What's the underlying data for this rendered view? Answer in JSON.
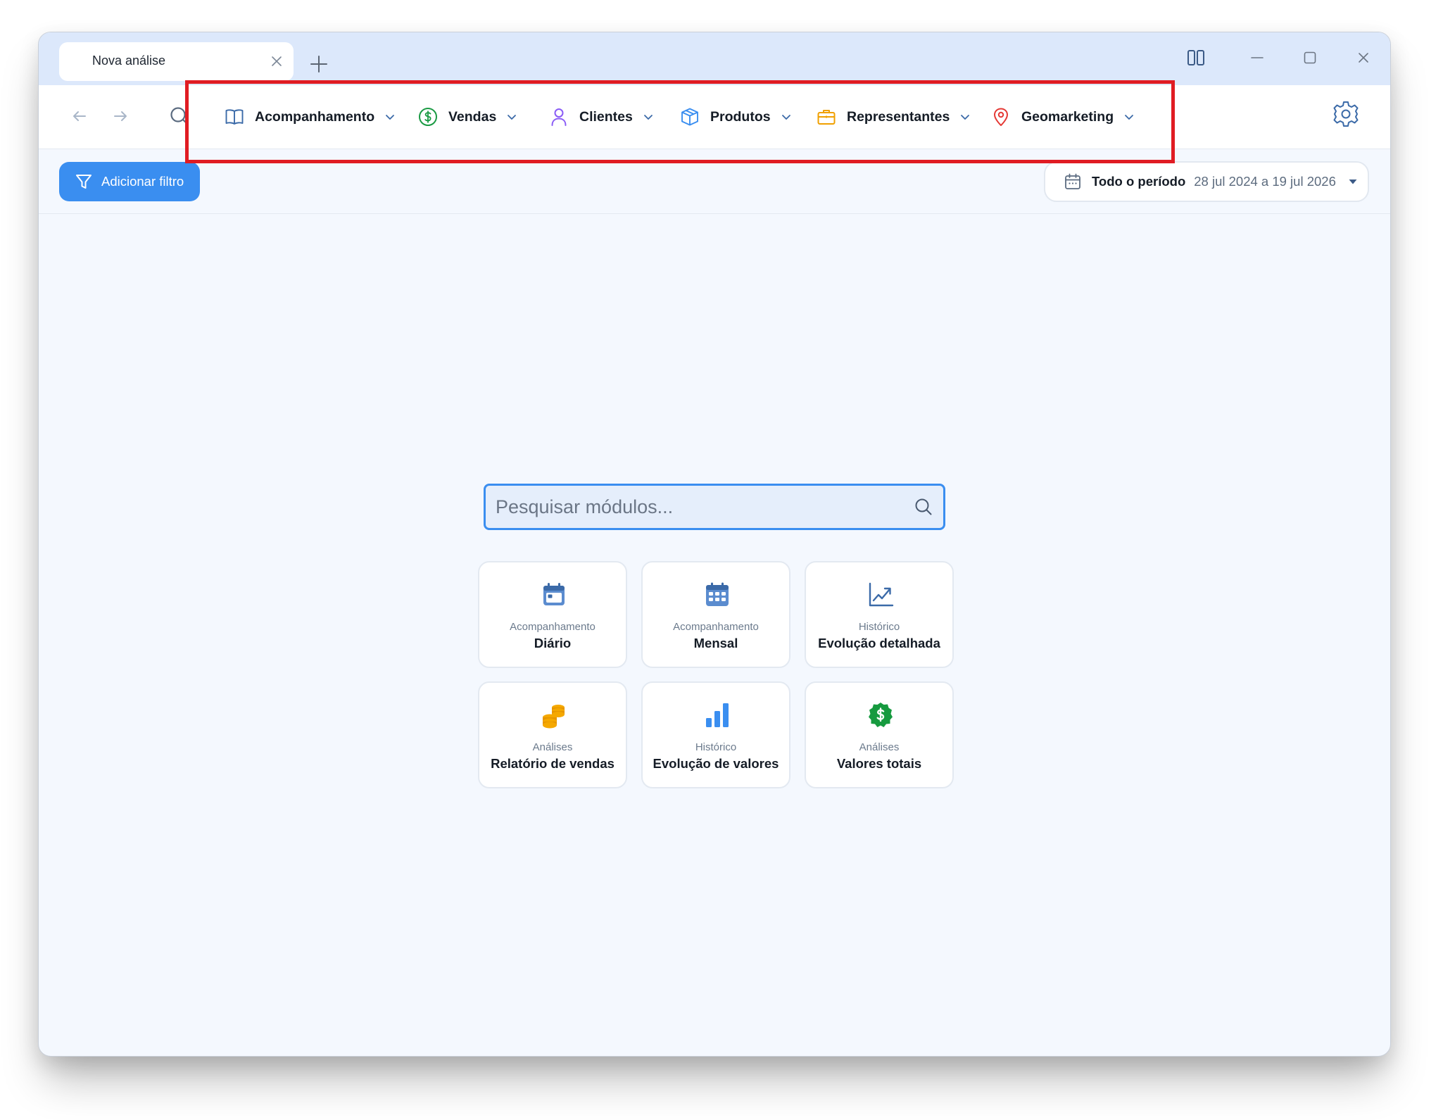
{
  "tab": {
    "title": "Nova análise"
  },
  "menu": [
    {
      "label": "Acompanhamento",
      "icon": "book-icon",
      "color": "#3b6aa8"
    },
    {
      "label": "Vendas",
      "icon": "dollar-circle-icon",
      "color": "#1a9a43"
    },
    {
      "label": "Clientes",
      "icon": "user-icon",
      "color": "#8a5cf6"
    },
    {
      "label": "Produtos",
      "icon": "box-icon",
      "color": "#3a8ef0"
    },
    {
      "label": "Representantes",
      "icon": "briefcase-icon",
      "color": "#f0a000"
    },
    {
      "label": "Geomarketing",
      "icon": "map-pin-icon",
      "color": "#e53935"
    }
  ],
  "filter": {
    "add_label": "Adicionar filtro"
  },
  "period": {
    "label": "Todo o período",
    "range": "28 jul 2024 a 19 jul 2026"
  },
  "search": {
    "placeholder": "Pesquisar módulos..."
  },
  "modules": [
    {
      "category": "Acompanhamento",
      "title": "Diário",
      "icon": "calendar-day-icon"
    },
    {
      "category": "Acompanhamento",
      "title": "Mensal",
      "icon": "calendar-month-icon"
    },
    {
      "category": "Histórico",
      "title": "Evolução detalhada",
      "icon": "trend-chart-icon"
    },
    {
      "category": "Análises",
      "title": "Relatório de vendas",
      "icon": "coins-icon"
    },
    {
      "category": "Histórico",
      "title": "Evolução de valores",
      "icon": "bar-chart-icon"
    },
    {
      "category": "Análises",
      "title": "Valores totais",
      "icon": "dollar-badge-icon"
    }
  ],
  "colors": {
    "accent": "#3a8ef0",
    "highlight": "#e01c23",
    "titlebar": "#dce8fb",
    "background": "#f4f8fe"
  }
}
